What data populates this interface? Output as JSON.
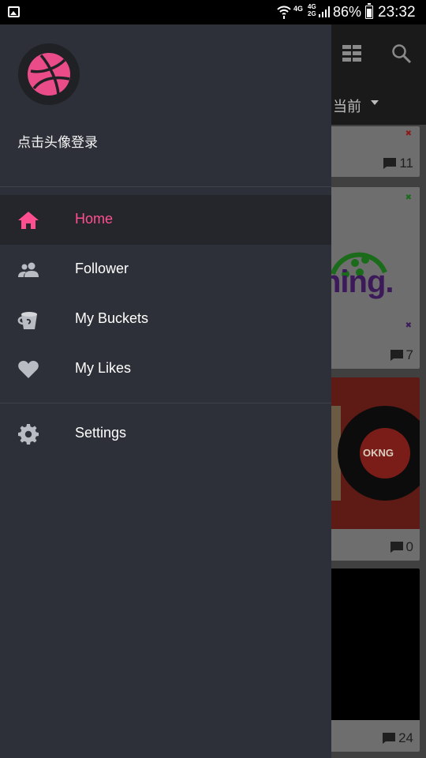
{
  "status_bar": {
    "network_1": "4G",
    "network_2_top": "4G",
    "network_2_bottom": "2G",
    "battery_percent": "86%",
    "time": "23:32"
  },
  "background_app": {
    "sort_label": "当前",
    "cards": [
      {
        "comment_count": "11"
      },
      {
        "logo_text": "ning.",
        "comment_count": "7"
      },
      {
        "art_text": "OKNG",
        "comment_count": "0"
      },
      {
        "comment_count": "24"
      }
    ]
  },
  "drawer": {
    "login_prompt": "点击头像登录",
    "menu": [
      {
        "label": "Home",
        "icon": "home-icon",
        "active": true
      },
      {
        "label": "Follower",
        "icon": "people-icon",
        "active": false
      },
      {
        "label": "My Buckets",
        "icon": "bucket-icon",
        "active": false
      },
      {
        "label": "My Likes",
        "icon": "heart-icon",
        "active": false
      }
    ],
    "settings": {
      "label": "Settings",
      "icon": "gear-icon"
    }
  },
  "colors": {
    "accent": "#ff4f91",
    "drawer_bg": "#2d3038",
    "active_item_bg": "#24262c",
    "icon_grey": "#b9bcc2"
  }
}
